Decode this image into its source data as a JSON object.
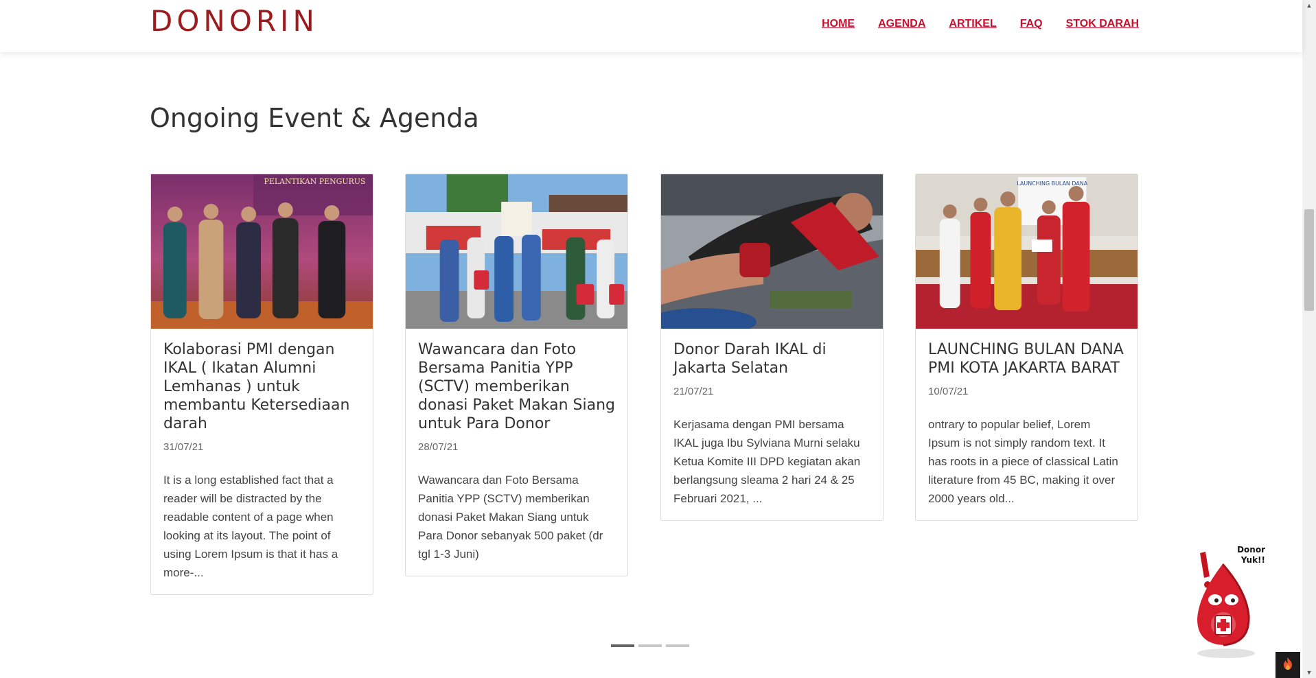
{
  "header": {
    "logo": "DONORIN",
    "nav": [
      "HOME",
      "AGENDA",
      "ARTIKEL",
      "FAQ",
      "STOK DARAH"
    ]
  },
  "section": {
    "title": "Ongoing Event & Agenda"
  },
  "cards": [
    {
      "title": "Kolaborasi PMI dengan IKAL ( Ikatan Alumni Lemhanas ) untuk membantu Ketersediaan darah",
      "date": "31/07/21",
      "excerpt": "It is a long established fact that a reader will be distracted by the readable content of a page when looking at its layout. The point of using Lorem Ipsum is that it has a more-...",
      "image_banner": "PELANTIKAN PENGURUS"
    },
    {
      "title": "Wawancara dan Foto Bersama Panitia YPP (SCTV) memberikan donasi Paket Makan Siang untuk Para Donor",
      "date": "28/07/21",
      "excerpt": "Wawancara dan Foto Bersama Panitia YPP (SCTV) memberikan donasi Paket Makan Siang untuk Para Donor sebanyak 500 paket (dr tgl 1-3 Juni)"
    },
    {
      "title": "Donor Darah IKAL di Jakarta Selatan",
      "date": "21/07/21",
      "excerpt": "Kerjasama dengan PMI bersama IKAL juga Ibu Sylviana Murni selaku Ketua Komite III DPD kegiatan akan berlangsung sleama 2 hari 24 & 25 Februari 2021, ..."
    },
    {
      "title": "LAUNCHING BULAN DANA PMI KOTA JAKARTA BARAT",
      "date": "10/07/21",
      "excerpt": "ontrary to popular belief, Lorem Ipsum is not simply random text. It has roots in a piece of classical Latin literature from 45 BC, making it over 2000 years old...",
      "image_banner": "LAUNCHING BULAN DANA"
    }
  ],
  "carousel": {
    "pages": 3,
    "active_index": 0
  },
  "mascot": {
    "line1": "Donor",
    "line2": "Yuk!!"
  },
  "colors": {
    "brand": "#9b1c1f",
    "nav": "#c8102e",
    "mascot": "#d81e2c"
  },
  "icons": {
    "corner_button": "flame-icon"
  }
}
